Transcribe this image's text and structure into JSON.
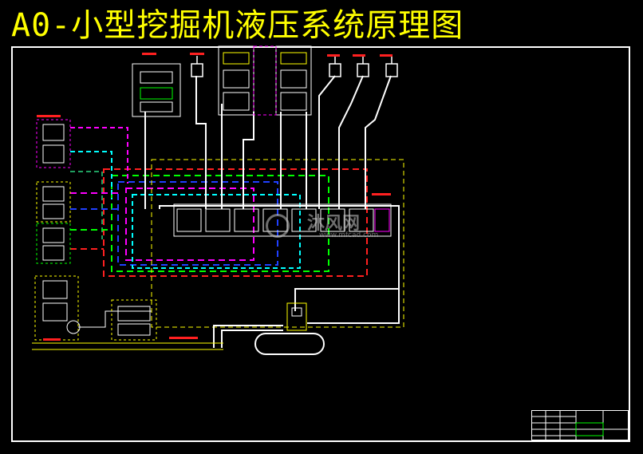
{
  "drawing": {
    "title": "A0-小型挖掘机液压系统原理图"
  },
  "watermark": {
    "text": "沐风网",
    "url": "www.mfcad.com"
  },
  "colors": {
    "background": "#000000",
    "title": "#ffff00",
    "frame": "#ffffff",
    "line_red": "#ff2020",
    "line_green": "#00ff00",
    "line_blue": "#2040ff",
    "line_magenta": "#ff00ff",
    "line_cyan": "#00ffff",
    "line_yellow": "#ffff00",
    "line_white": "#ffffff"
  }
}
